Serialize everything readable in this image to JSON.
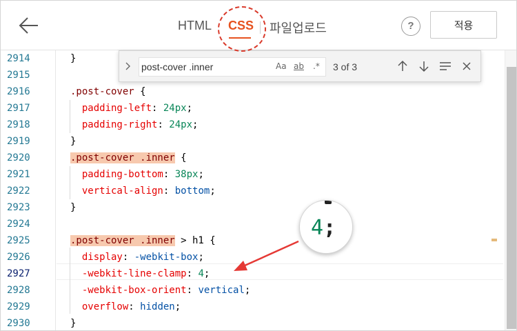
{
  "header": {
    "tabs": [
      {
        "label": "HTML"
      },
      {
        "label": "CSS"
      },
      {
        "label": "파일업로드"
      }
    ],
    "active_tab": "CSS",
    "help_label": "?",
    "apply_label": "적용"
  },
  "find": {
    "query": "post-cover .inner",
    "options": [
      "Aa",
      "ab",
      ".*"
    ],
    "match_count": "3 of 3"
  },
  "editor": {
    "line_numbers": [
      "2914",
      "2915",
      "2916",
      "2917",
      "2918",
      "2919",
      "2920",
      "2921",
      "2922",
      "2923",
      "2924",
      "2925",
      "2926",
      "2927",
      "2928",
      "2929",
      "2930"
    ],
    "active_line": "2927",
    "code": {
      "l2914": "}",
      "l2916_sel": ".post-cover",
      "l2916_rest": " {",
      "l2917_prop": "padding-left",
      "l2917_val": "24px",
      "l2918_prop": "padding-right",
      "l2918_val": "24px",
      "l2919": "}",
      "l2920_sel": ".post-cover .inner",
      "l2920_rest": " {",
      "l2921_prop": "padding-bottom",
      "l2921_val": "38px",
      "l2922_prop": "vertical-align",
      "l2922_val": "bottom",
      "l2923": "}",
      "l2925_sel": ".post-cover .inner",
      "l2925_rest": " > h1 {",
      "l2926_prop": "display",
      "l2926_val": "-webkit-box",
      "l2927_prop": "-webkit-line-clamp",
      "l2927_val": "4",
      "l2928_prop": "-webkit-box-orient",
      "l2928_val": "vertical",
      "l2929_prop": "overflow",
      "l2929_val": "hidden",
      "l2930": "}"
    }
  },
  "callout": {
    "digit": "4",
    "semicolon": ";"
  },
  "colors": {
    "accent": "#e6521f",
    "annotation": "#d93a2b",
    "line_number": "#237893",
    "selector": "#800000",
    "property": "#e50000",
    "number": "#098658",
    "keyword": "#0451a5",
    "search_match": "#f7c9ae"
  },
  "icons": [
    "back-arrow-icon",
    "help-icon",
    "chevron-right-icon",
    "arrow-up-icon",
    "arrow-down-icon",
    "find-in-selection-icon",
    "close-icon"
  ]
}
